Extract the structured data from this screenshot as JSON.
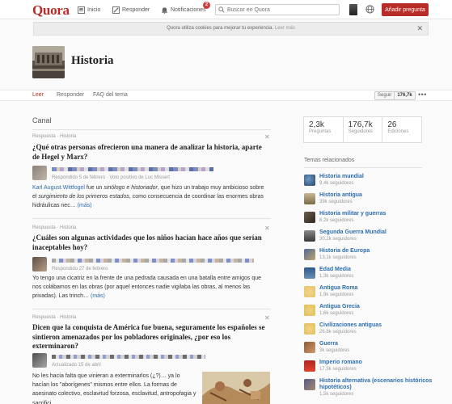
{
  "header": {
    "logo": "Quora",
    "nav": [
      {
        "label": "Inicio",
        "icon": "home-icon"
      },
      {
        "label": "Responder",
        "icon": "pencil-icon"
      },
      {
        "label": "Notificaciones",
        "icon": "bell-icon"
      }
    ],
    "notification_count": "2",
    "search_placeholder": "Buscar en Quora",
    "ask_button": "Añadir pregunta",
    "brand_color": "#b92b27"
  },
  "cookie_bar": {
    "text": "Quora utiliza cookies para mejorar tu experiencia.",
    "link": "Leer más",
    "close": "✕"
  },
  "topic": {
    "title": "Historia",
    "tabs": [
      "Leer",
      "Responder",
      "FAQ del tema"
    ],
    "follow_label": "Seguir",
    "follow_count": "176,7k",
    "more": "•••"
  },
  "feed": {
    "heading": "Canal",
    "items": [
      {
        "meta": "Respuesta · Historia",
        "title": "¿Qué otras personas ofrecieron una manera de analizar la historia, aparte de Hegel y Marx?",
        "date": "Respondido 5 de febrero · Voto positivo de Luc Missert",
        "text_link": "Karl August Wittfogel",
        "text_a": " fue un ",
        "text_em1": "sinólogo e historiador",
        "text_b": ", que hizo un trabajo muy ambicioso sobre el ",
        "text_em2": "surgimiento de los primeros estados",
        "text_c": ", como consecuencia de coordinar las enormes obras hidráulicas nec…",
        "more": "(más)"
      },
      {
        "meta": "Respuesta · Historia",
        "title": "¿Cuáles son algunas actividades que los niños hacían hace años que serían inaceptables hoy?",
        "date": "Respondido 27 de febrero",
        "text": "Yo tengo una cicatriz en la frente de una pedrada causada en una batalla entre amigos que nos colábamos en las obras (por aquel entonces nadie vigilaba las obras, al menos las privadas). Las trinch…",
        "more": "(más)"
      },
      {
        "meta": "Respuesta · Historia",
        "title": "Dicen que la conquista de América fue buena, seguramente los españoles se sintieron amenazados por los pobladores originales, ¿por eso los exterminaron?",
        "date": "Actualizado 15 de abril",
        "text": "No les hacía falta que vinieran a exterminarlos (¿?)… ya lo hacían los \"aborígenes\" mismos entre ellos. La formas de asesinato colectivo, esclavitud forzosa, esclavitud, antropofagia y sacrifici…"
      }
    ]
  },
  "stats": [
    {
      "value": "2,3k",
      "label": "Preguntas"
    },
    {
      "value": "176,7k",
      "label": "Seguidores"
    },
    {
      "value": "26",
      "label": "Ediciones"
    }
  ],
  "related": {
    "heading": "Temas relacionados",
    "items": [
      {
        "name": "Historia mundial",
        "sub": "9,4k seguidores"
      },
      {
        "name": "Historia antigua",
        "sub": "39k seguidores"
      },
      {
        "name": "Historia militar y guerras",
        "sub": "8,2k seguidores"
      },
      {
        "name": "Segunda Guerra Mundial",
        "sub": "30,2k seguidores"
      },
      {
        "name": "Historia de Europa",
        "sub": "13,1k seguidores"
      },
      {
        "name": "Edad Media",
        "sub": "1,3k seguidores"
      },
      {
        "name": "Antigua Roma",
        "sub": "1,9k seguidores"
      },
      {
        "name": "Antigua Grecia",
        "sub": "1,6k seguidores"
      },
      {
        "name": "Civilizaciones antiguas",
        "sub": "26,8k seguidores"
      },
      {
        "name": "Guerra",
        "sub": "3k seguidores"
      },
      {
        "name": "Imperio romano",
        "sub": "17,5k seguidores"
      },
      {
        "name": "Historia alternativa (escenarios históricos hipotéticos)",
        "sub": "1,5k seguidores"
      }
    ]
  }
}
